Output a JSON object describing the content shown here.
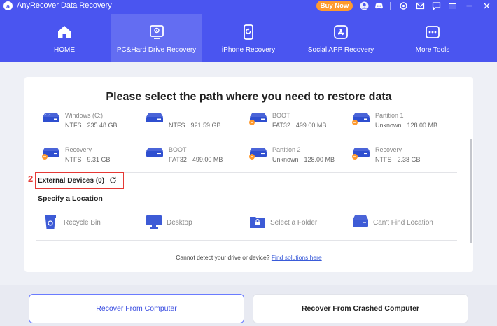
{
  "app": {
    "title": "AnyRecover Data Recovery",
    "logo_letter": "a",
    "buy_label": "Buy Now",
    "accent_color": "#4a55f0",
    "buy_color": "#ff9a2e",
    "toolbar_icons": [
      "user-icon",
      "discord-icon",
      "settings-icon",
      "mail-icon",
      "chat-icon",
      "menu-icon",
      "minimize-icon",
      "close-icon"
    ]
  },
  "tabs": [
    {
      "label": "HOME",
      "icon": "home-icon",
      "active": false
    },
    {
      "label": "PC&Hard Drive Recovery",
      "icon": "pc-drive-icon",
      "active": true
    },
    {
      "label": "iPhone Recovery",
      "icon": "iphone-icon",
      "active": false
    },
    {
      "label": "Social APP Recovery",
      "icon": "app-store-icon",
      "active": false
    },
    {
      "label": "More Tools",
      "icon": "more-tools-icon",
      "active": false
    }
  ],
  "main": {
    "title": "Please select the path where you need to restore data",
    "drives": [
      {
        "name": "Windows (C:)",
        "fs": "NTFS",
        "size": "235.48 GB",
        "type": "system"
      },
      {
        "name": "",
        "fs": "NTFS",
        "size": "921.59 GB",
        "type": "normal"
      },
      {
        "name": "BOOT",
        "fs": "FAT32",
        "size": "499.00 MB",
        "type": "hidden"
      },
      {
        "name": "Partition 1",
        "fs": "Unknown",
        "size": "128.00 MB",
        "type": "hidden"
      },
      {
        "name": "Recovery",
        "fs": "NTFS",
        "size": "9.31 GB",
        "type": "hidden"
      },
      {
        "name": "BOOT",
        "fs": "FAT32",
        "size": "499.00 MB",
        "type": "normal"
      },
      {
        "name": "Partition 2",
        "fs": "Unknown",
        "size": "128.00 MB",
        "type": "hidden"
      },
      {
        "name": "Recovery",
        "fs": "NTFS",
        "size": "2.38 GB",
        "type": "hidden"
      }
    ],
    "external_label": "External Devices (0)",
    "step_number": "2",
    "location_heading": "Specify a Location",
    "locations": [
      {
        "label": "Recycle Bin",
        "icon": "recycle-bin-icon"
      },
      {
        "label": "Desktop",
        "icon": "desktop-icon"
      },
      {
        "label": "Select a Folder",
        "icon": "folder-icon"
      },
      {
        "label": "Can't Find Location",
        "icon": "drive-question-icon"
      }
    ],
    "help_text": "Cannot detect your drive or device?",
    "help_link": "Find solutions here"
  },
  "footer": {
    "recover_computer": "Recover From Computer",
    "recover_crashed": "Recover From Crashed Computer"
  }
}
